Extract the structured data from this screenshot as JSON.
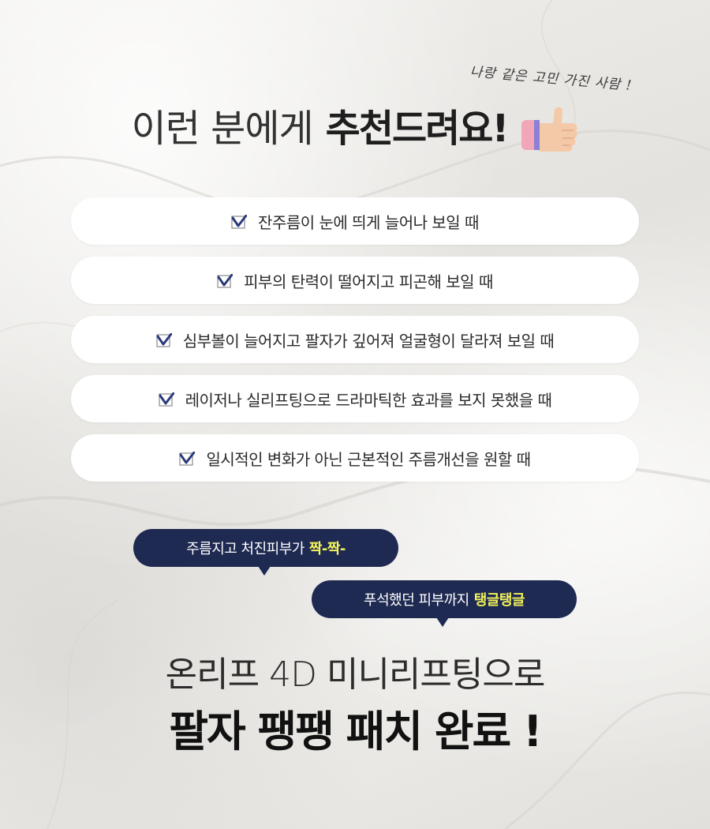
{
  "handwritten_note": "나랑 같은 고민 가진 사람 !",
  "headline": {
    "light": "이런 분에게",
    "bold": "추천드려요!",
    "icon": "thumbs-up-icon"
  },
  "checklist": [
    "잔주름이 눈에 띄게 늘어나 보일 때",
    "피부의 탄력이 떨어지고 피곤해 보일 때",
    "심부볼이 늘어지고 팔자가 깊어져 얼굴형이 달라져 보일 때",
    "레이저나 실리프팅으로 드라마틱한 효과를 보지 못했을 때",
    "일시적인 변화가 아닌 근본적인 주름개선을 원할 때"
  ],
  "bubbles": [
    {
      "text": "주름지고 처진피부가",
      "highlight": "짝-짝-"
    },
    {
      "text": "푸석했던 피부까지",
      "highlight": "탱글탱글"
    }
  ],
  "subtitle": "온리프 4D 미니리프팅으로",
  "final_title": "팔자 팽팽 패치 완료 !",
  "colors": {
    "bubble_bg": "#1f2a52",
    "highlight": "#f2f25a",
    "check": "#2b3a7a",
    "card_bg": "#ffffff"
  }
}
